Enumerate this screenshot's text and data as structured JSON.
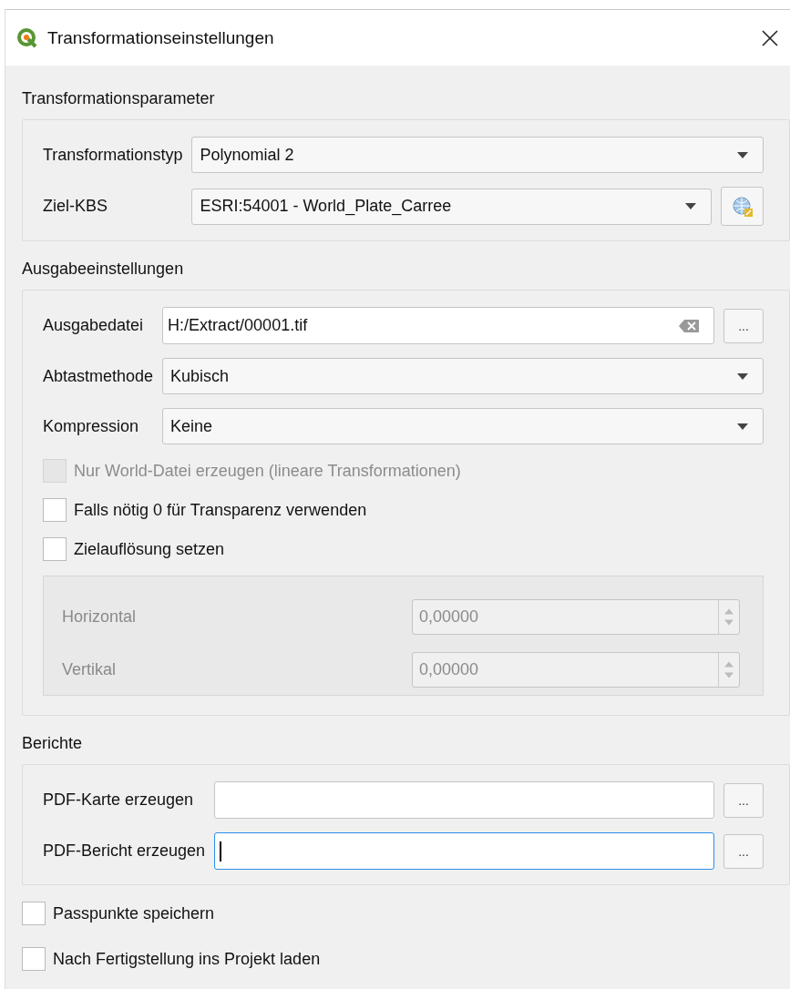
{
  "window": {
    "title": "Transformationseinstellungen"
  },
  "sections": [
    {
      "title": "Transformationsparameter",
      "rows": [
        {
          "kind": "combo",
          "label": "Transformationstyp",
          "value": "Polynomial 2"
        },
        {
          "kind": "crs",
          "label": "Ziel-KBS",
          "value": "ESRI:54001 - World_Plate_Carree"
        }
      ]
    },
    {
      "title": "Ausgabeeinstellungen",
      "rows": [
        {
          "kind": "file",
          "label": "Ausgabedatei",
          "value": "H:/Extract/00001.tif",
          "clearable": true,
          "focused": false,
          "browse": "..."
        },
        {
          "kind": "combo",
          "label": "Abtastmethode",
          "value": "Kubisch"
        },
        {
          "kind": "combo",
          "label": "Kompression",
          "value": "Keine"
        },
        {
          "kind": "checkbox",
          "label": "Nur World-Datei erzeugen (lineare Transformationen)",
          "checked": false,
          "disabled": true
        },
        {
          "kind": "checkbox",
          "label": "Falls nötig 0 für Transparenz verwenden",
          "checked": false,
          "disabled": false
        },
        {
          "kind": "checkbox",
          "label": "Zielauflösung setzen",
          "checked": false,
          "disabled": false
        },
        {
          "kind": "subgroup",
          "disabled": true,
          "rows": [
            {
              "label": "Horizontal",
              "value": "0,00000"
            },
            {
              "label": "Vertikal",
              "value": "0,00000"
            }
          ]
        }
      ]
    },
    {
      "title": "Berichte",
      "rows": [
        {
          "kind": "file",
          "label": "PDF-Karte erzeugen",
          "clearable": false,
          "focused": false,
          "browse": "..."
        },
        {
          "kind": "file",
          "label": "PDF-Bericht erzeugen",
          "clearable": false,
          "focused": true,
          "browse": "..."
        }
      ]
    }
  ],
  "options": [
    {
      "label": "Passpunkte speichern",
      "checked": false,
      "disabled": false
    },
    {
      "label": "Nach Fertigstellung ins Projekt laden",
      "checked": false,
      "disabled": false
    }
  ]
}
